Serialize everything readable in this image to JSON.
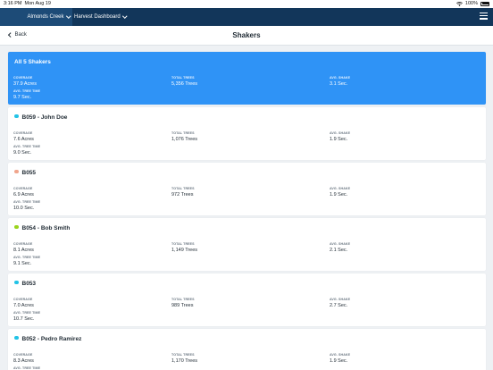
{
  "status_bar": {
    "time": "3:16 PM",
    "date": "Mon Aug 19",
    "battery": "100%"
  },
  "nav": {
    "farm": "Almonds Creek",
    "dashboard": "Harvest Dashboard",
    "menu_icon": "hamburger-icon"
  },
  "header": {
    "back": "Back",
    "title": "Shakers"
  },
  "labels": {
    "coverage": "COVERAGE",
    "total_trees": "TOTAL TREES",
    "avg_shake": "AVG. SHAKE",
    "avg_tree_time": "AVG. TREE TIME"
  },
  "summary": {
    "title": "All 5 Shakers",
    "coverage": "37.9 Acres",
    "total_trees": "5,356 Trees",
    "avg_shake": "3.1 Sec.",
    "avg_tree_time": "9.7 Sec."
  },
  "shakers": [
    {
      "name": "B059  - John Doe",
      "color": "#22c3e6",
      "coverage": "7.6 Acres",
      "total_trees": "1,076 Trees",
      "avg_shake": "1.9 Sec.",
      "avg_tree_time": "9.0 Sec."
    },
    {
      "name": "B055",
      "color": "#f0a58c",
      "coverage": "6.9 Acres",
      "total_trees": "972 Trees",
      "avg_shake": "1.9 Sec.",
      "avg_tree_time": "10.0 Sec."
    },
    {
      "name": "B054  - Bob Smith",
      "color": "#9ad41c",
      "coverage": "8.1 Acres",
      "total_trees": "1,149 Trees",
      "avg_shake": "2.1 Sec.",
      "avg_tree_time": "9.1 Sec."
    },
    {
      "name": "B053",
      "color": "#22c3e6",
      "coverage": "7.0 Acres",
      "total_trees": "989 Trees",
      "avg_shake": "2.7 Sec.",
      "avg_tree_time": "10.7 Sec."
    },
    {
      "name": "B052  - Pedro Ramirez",
      "color": "#22c3e6",
      "coverage": "8.3 Acres",
      "total_trees": "1,170 Trees",
      "avg_shake": "1.9 Sec.",
      "avg_tree_time": ""
    }
  ]
}
